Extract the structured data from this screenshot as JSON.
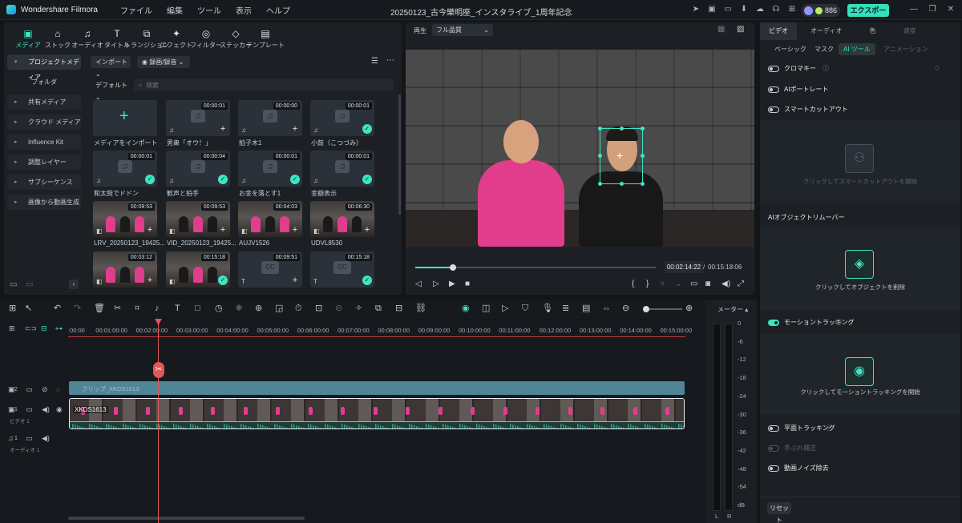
{
  "titlebar": {
    "app_name": "Wondershare Filmora",
    "menus": [
      "ファイル",
      "編集",
      "ツール",
      "表示",
      "ヘルプ"
    ],
    "doc_title": "20250123_古今樂明座_インスタライブ_1周年記念",
    "credits": "886",
    "export_label": "エクスポート"
  },
  "media": {
    "tools": [
      {
        "icon": "▣",
        "label": "メディア"
      },
      {
        "icon": "⌂",
        "label": "ストック"
      },
      {
        "icon": "♫",
        "label": "オーディオ"
      },
      {
        "icon": "T",
        "label": "タイトル"
      },
      {
        "icon": "⧉",
        "label": "トランジション"
      },
      {
        "icon": "✦",
        "label": "エフェクト"
      },
      {
        "icon": "◎",
        "label": "フィルター"
      },
      {
        "icon": "◇",
        "label": "ステッカー"
      },
      {
        "icon": "▤",
        "label": "テンプレート"
      }
    ],
    "nav": [
      "プロジェクトメディア",
      "フォルダ",
      "共有メディア",
      "クラウド メディア",
      "Influence Kit",
      "調整レイヤー",
      "サブシーケンス",
      "画像から動画生成"
    ],
    "import_label": "インポート",
    "record_label": "録画/録音",
    "sort_label": "デフォルト",
    "search_placeholder": "検索",
    "tiles": [
      {
        "name": "メディアをインポート",
        "dur": "",
        "kind": "import",
        "badge": ""
      },
      {
        "name": "男衆「オウ！」",
        "dur": "00:00:01",
        "kind": "audio",
        "badge": "add"
      },
      {
        "name": "拍子木1",
        "dur": "00:00:00",
        "kind": "audio",
        "badge": "add"
      },
      {
        "name": "小鼓（こつづみ）",
        "dur": "00:00:01",
        "kind": "audio",
        "badge": "ok"
      },
      {
        "name": "和太鼓でドドン",
        "dur": "00:00:01",
        "kind": "audio",
        "badge": "ok"
      },
      {
        "name": "歓声と拍手",
        "dur": "00:00:04",
        "kind": "audio",
        "badge": "ok"
      },
      {
        "name": "お金を落とす1",
        "dur": "00:00:01",
        "kind": "audio",
        "badge": "ok"
      },
      {
        "name": "金額表示",
        "dur": "00:00:01",
        "kind": "audio",
        "badge": "ok"
      },
      {
        "name": "LRV_20250123_19425...",
        "dur": "00:09:53",
        "kind": "video",
        "badge": "add"
      },
      {
        "name": "VID_20250123_19425...",
        "dur": "00:09:53",
        "kind": "video",
        "badge": "add"
      },
      {
        "name": "AUJV1526",
        "dur": "00:04:03",
        "kind": "video",
        "badge": "add"
      },
      {
        "name": "UDVL8530",
        "dur": "00:06:30",
        "kind": "video",
        "badge": "add"
      },
      {
        "name": "",
        "dur": "00:03:12",
        "kind": "video",
        "badge": "add"
      },
      {
        "name": "",
        "dur": "00:15:18",
        "kind": "video",
        "badge": "ok"
      },
      {
        "name": "",
        "dur": "00:09:51",
        "kind": "title",
        "badge": "add"
      },
      {
        "name": "",
        "dur": "00:15:18",
        "kind": "title",
        "badge": "ok"
      }
    ]
  },
  "player": {
    "label": "再生",
    "quality": "フル品質",
    "current_time": "00:02:14:22",
    "separator": "/",
    "total_time": "00:15:18:06",
    "progress": 0.155
  },
  "right": {
    "tabs": [
      "ビデオ",
      "オーディオ",
      "色",
      "速度"
    ],
    "subtabs": [
      "ベーシック",
      "マスク",
      "AI ツール",
      "アニメーション"
    ],
    "chroma": "クロマキー",
    "portrait": "AIポートレート",
    "smartcut": "スマートカットアウト",
    "smartcut_caption": "クリックしてスマートカットアウトを開始",
    "remover_title": "AIオブジェクトリムーバー",
    "remover_caption": "クリックしてオブジェクトを削除",
    "motion": "モーショントラッキング",
    "motion_caption": "クリックしてモーショントラッキングを開始",
    "planar": "平面トラッキング",
    "stabilize": "手ぶれ補正",
    "denoise": "動画ノイズ除去",
    "reset": "リセット"
  },
  "timeline": {
    "ruler": [
      ":00:00",
      "00:01:00:00",
      "00:02:00:00",
      "00:03:00:00",
      "00:04:00:00",
      "00:05:00:00",
      "00:06:00:00",
      "00:07:00:00",
      "00:08:00:00",
      "00:09:00:00",
      "00:10:00:00",
      "00:11:00:00",
      "00:12:00:00",
      "00:13:00:00",
      "00:14:00:00",
      "00:15:00:00"
    ],
    "track2_clip": "クリップ_XKDS1613",
    "track1_clip": "XKDS1613",
    "track2_num": "2",
    "track1_num": "1",
    "audio_num": "1",
    "video_label": "ビデオ 1",
    "audio_label": "オーディオ 1"
  },
  "meter": {
    "title": "メーター",
    "ticks": [
      "0",
      "-6",
      "-12",
      "-18",
      "-24",
      "-30",
      "-36",
      "-42",
      "-48",
      "-54",
      "dB"
    ],
    "left": "L",
    "right": "R"
  },
  "colors": {
    "accent": "#3ee5c2",
    "playhead": "#e05757",
    "pink": "#e23d8c"
  }
}
